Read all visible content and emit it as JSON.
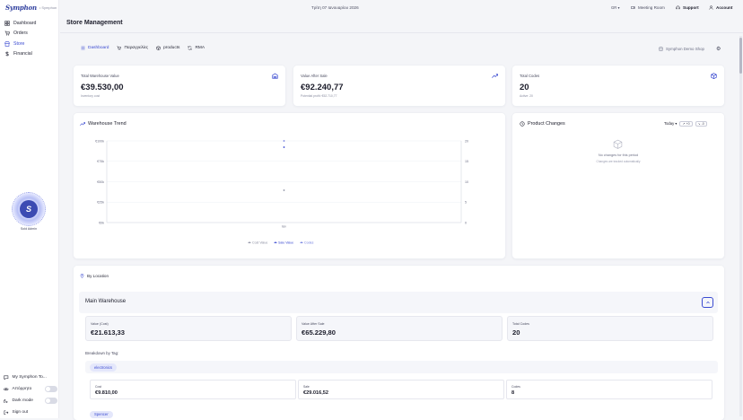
{
  "brand": {
    "logo": "Symphon",
    "sub": "• Symphon"
  },
  "nav": [
    {
      "label": "Dashboard",
      "icon": "grid-icon"
    },
    {
      "label": "Orders",
      "icon": "cart-icon"
    },
    {
      "label": "Store",
      "icon": "store-icon",
      "active": true
    },
    {
      "label": "Financial",
      "icon": "dollar-icon"
    }
  ],
  "user": {
    "name": "Sold Admin"
  },
  "side_bottom": {
    "tour": "My Symphon To...",
    "visibility": "Απόρρητο",
    "dark": "Dark mode",
    "signout": "Sign out"
  },
  "topbar": {
    "date": "Τρίτη 07 Ιανουαρίου 2026",
    "lang": "GR",
    "meeting": "Meeting Room",
    "support": "Support",
    "account": "Account"
  },
  "page": {
    "title": "Store Management"
  },
  "tabs": [
    {
      "label": "Dashboard",
      "active": true
    },
    {
      "label": "Παραγγελίες"
    },
    {
      "label": "products"
    },
    {
      "label": "RMA"
    }
  ],
  "shop": "Symphon Demo Shop",
  "kpis": [
    {
      "title": "Total Warehouse Value",
      "value": "€39.530,00",
      "sub": "Inventory cost"
    },
    {
      "title": "Value After Sale",
      "value": "€92.240,77",
      "sub": "Potential profit: €52.710,77"
    },
    {
      "title": "Total Codes",
      "value": "20",
      "sub": "Active: 20"
    }
  ],
  "trend": {
    "title": "Warehouse Trend",
    "legend": [
      "Cost Value",
      "Sale Value",
      "Codes"
    ]
  },
  "chart_data": {
    "type": "scatter",
    "title": "Warehouse Trend",
    "categories": [
      "Ιαν"
    ],
    "y_left_ticks": [
      "€100k",
      "€75k",
      "€50k",
      "€25k",
      "€0k"
    ],
    "y_right_ticks": [
      "20",
      "15",
      "10",
      "5",
      "0"
    ],
    "ylim_left": [
      0,
      100000
    ],
    "ylim_right": [
      0,
      20
    ],
    "series": [
      {
        "name": "Cost Value",
        "axis": "left",
        "values": [
          39530
        ],
        "color": "#8a8da0"
      },
      {
        "name": "Sale Value",
        "axis": "left",
        "values": [
          92240.77
        ],
        "color": "#3b4bd1"
      },
      {
        "name": "Codes",
        "axis": "right",
        "values": [
          20
        ],
        "color": "#6e7bde"
      }
    ]
  },
  "changes": {
    "title": "Product Changes",
    "period": "Today",
    "btn_plus": "+0",
    "btn_minus": "-0",
    "empty": "No changes for this period",
    "empty_sub": "Changes are tracked automatically"
  },
  "locations": {
    "title": "By Location",
    "warehouse": "Main Warehouse",
    "stats": [
      {
        "label": "Value (Cost)",
        "value": "€21.613,33"
      },
      {
        "label": "Value After Sale",
        "value": "€65.229,80"
      },
      {
        "label": "Total Codes",
        "value": "20"
      }
    ],
    "breakdown_title": "Breakdown by Tag:",
    "tags": [
      {
        "name": "electronics",
        "stats": [
          {
            "label": "Cost",
            "value": "€9.810,00"
          },
          {
            "label": "Sale",
            "value": "€29.016,52"
          },
          {
            "label": "Codes",
            "value": "8"
          }
        ]
      },
      {
        "name": "Spencer"
      }
    ]
  }
}
